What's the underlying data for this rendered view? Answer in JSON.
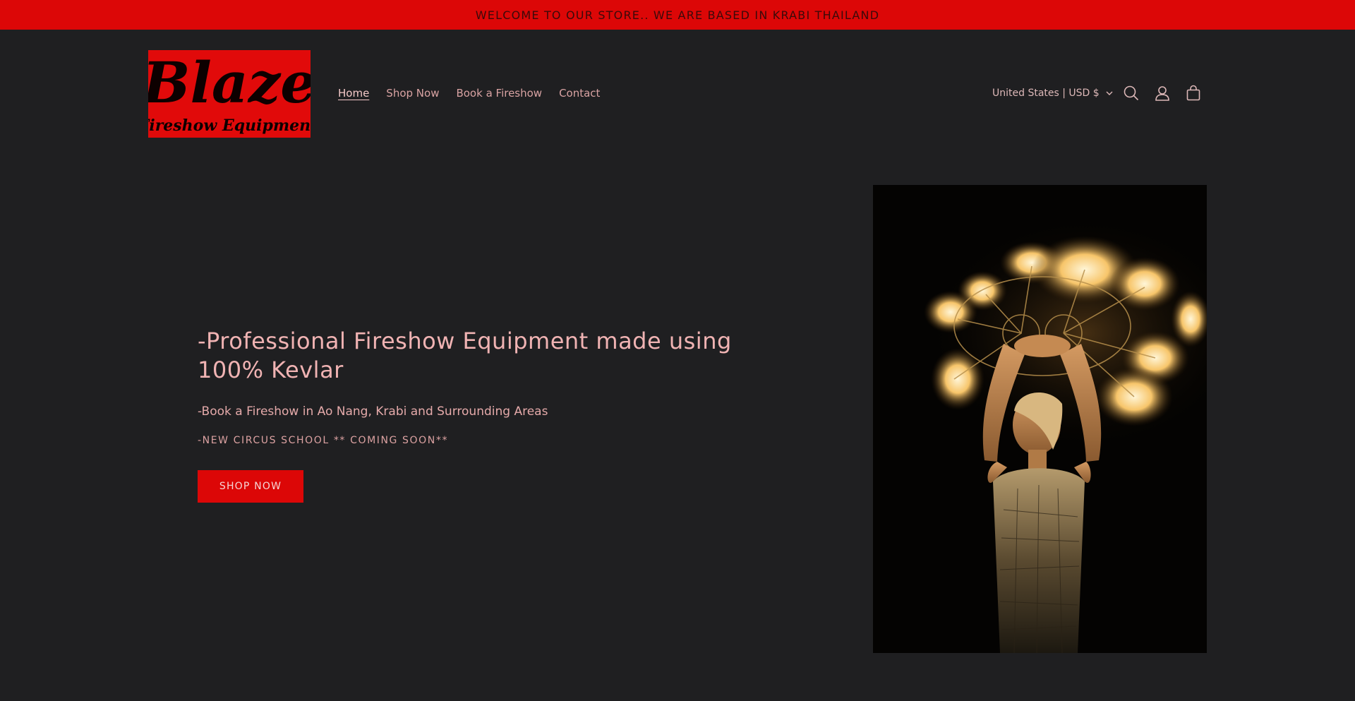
{
  "announcement": {
    "text": "WELCOME TO OUR STORE.. WE ARE BASED IN KRABI THAILAND",
    "background": "#dc0707"
  },
  "header": {
    "logo": {
      "title": "Blaze",
      "subtitle": "Fireshow Equipment"
    },
    "nav": [
      {
        "label": "Home",
        "active": true
      },
      {
        "label": "Shop Now",
        "active": false
      },
      {
        "label": "Book a Fireshow",
        "active": false
      },
      {
        "label": "Contact",
        "active": false
      }
    ],
    "country_selector": "United States | USD $",
    "icons": [
      "search-icon",
      "account-icon",
      "cart-icon"
    ]
  },
  "hero": {
    "title": "-Professional Fireshow Equipment made using 100% Kevlar",
    "subtitle": "-Book a Fireshow in Ao Nang, Krabi and Surrounding Areas",
    "note": "-NEW CIRCUS SCHOOL ** COMING SOON**",
    "button_label": "SHOP NOW",
    "image_icon": "fire-dancer-photo"
  },
  "colors": {
    "page_background": "#1f1f21",
    "accent_red": "#dc0707",
    "text_pink": "#f0b3b3"
  }
}
